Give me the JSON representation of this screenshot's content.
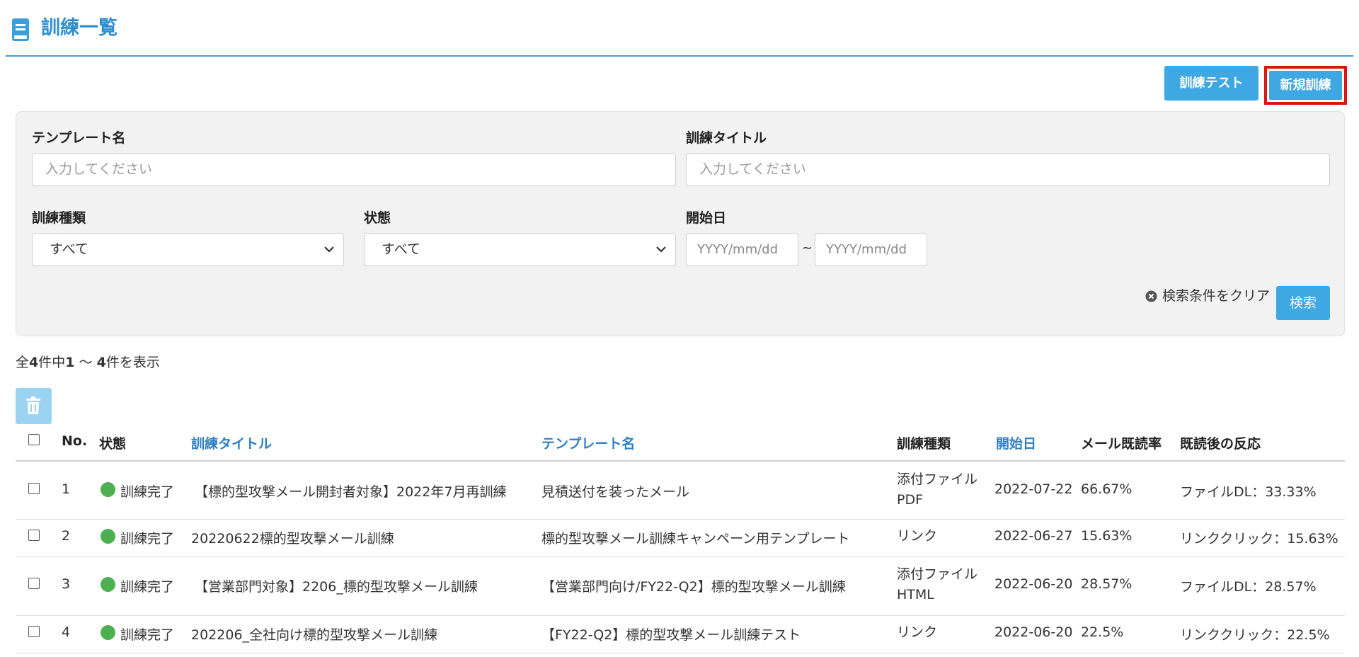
{
  "header": {
    "title": "訓練一覧"
  },
  "toolbar": {
    "test_label": "訓練テスト",
    "new_label": "新規訓練"
  },
  "search": {
    "template_label": "テンプレート名",
    "template_placeholder": "入力してください",
    "title_label": "訓練タイトル",
    "title_placeholder": "入力してください",
    "type_label": "訓練種類",
    "type_value": "すべて",
    "status_label": "状態",
    "status_value": "すべて",
    "start_label": "開始日",
    "date_from_placeholder": "YYYY/mm/dd",
    "date_sep": "~",
    "date_to_placeholder": "YYYY/mm/dd",
    "clear_label": "検索条件をクリア",
    "search_label": "検索"
  },
  "results": {
    "prefix": "全",
    "total": "4",
    "mid1": "件中",
    "from": "1",
    "mid2": " ～ ",
    "to": "4",
    "suffix": "件を表示"
  },
  "table": {
    "headers": {
      "no": "No.",
      "status": "状態",
      "title": "訓練タイトル",
      "template": "テンプレート名",
      "type": "訓練種類",
      "start": "開始日",
      "read_rate": "メール既読率",
      "reaction": "既読後の反応"
    },
    "rows": [
      {
        "no": "1",
        "status": "訓練完了",
        "title": "【標的型攻撃メール開封者対象】2022年7月再訓練",
        "template": "見積送付を装ったメール",
        "type_line1": "添付ファイル",
        "type_line2": "PDF",
        "start": "2022-07-22",
        "read_rate": "66.67%",
        "reaction": "ファイルDL：33.33%"
      },
      {
        "no": "2",
        "status": "訓練完了",
        "title": "20220622標的型攻撃メール訓練",
        "template": "標的型攻撃メール訓練キャンペーン用テンプレート",
        "type_line1": "リンク",
        "type_line2": "",
        "start": "2022-06-27",
        "read_rate": "15.63%",
        "reaction": "リンククリック：15.63%"
      },
      {
        "no": "3",
        "status": "訓練完了",
        "title": "【営業部門対象】2206_標的型攻撃メール訓練",
        "template": "【営業部門向け/FY22-Q2】標的型攻撃メール訓練",
        "type_line1": "添付ファイル",
        "type_line2": "HTML",
        "start": "2022-06-20",
        "read_rate": "28.57%",
        "reaction": "ファイルDL：28.57%"
      },
      {
        "no": "4",
        "status": "訓練完了",
        "title": "202206_全社向け標的型攻撃メール訓練",
        "template": "【FY22-Q2】標的型攻撃メール訓練テスト",
        "type_line1": "リンク",
        "type_line2": "",
        "start": "2022-06-20",
        "read_rate": "22.5%",
        "reaction": "リンククリック：22.5%"
      }
    ]
  },
  "colors": {
    "accent": "#3fa7e1",
    "title": "#2e8fd0",
    "highlight_border": "#d8141a",
    "status_done": "#4caf50",
    "link": "#2e80c4"
  }
}
